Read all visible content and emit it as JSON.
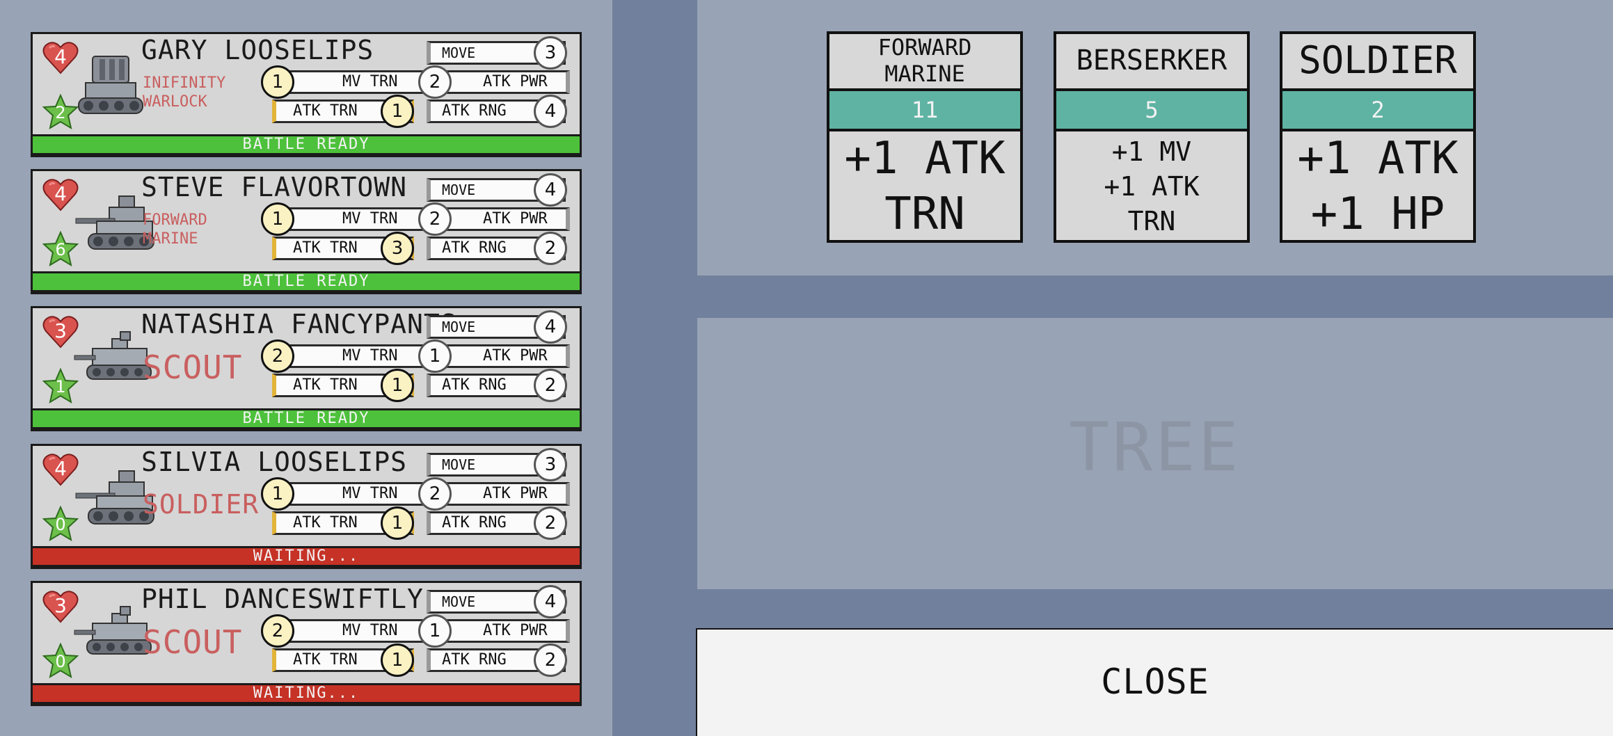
{
  "units": [
    {
      "name": "GARY LOOSELIPS",
      "unit_class": "INIFINITY WARLOCK",
      "class_size": "small",
      "hp": "4",
      "level": "2",
      "move": "3",
      "atk_pwr": "2",
      "atk_rng": "4",
      "mv_trn": "1",
      "atk_trn": "1",
      "status": "BATTLE READY",
      "ready": true,
      "tank": "mech"
    },
    {
      "name": "STEVE FLAVORTOWN",
      "unit_class": "FORWARD MARINE",
      "class_size": "small",
      "hp": "4",
      "level": "6",
      "move": "4",
      "atk_pwr": "2",
      "atk_rng": "2",
      "mv_trn": "1",
      "atk_trn": "3",
      "status": "BATTLE READY",
      "ready": true,
      "tank": "tank"
    },
    {
      "name": "NATASHIA FANCYPANTS",
      "unit_class": "SCOUT",
      "class_size": "large",
      "hp": "3",
      "level": "1",
      "move": "4",
      "atk_pwr": "1",
      "atk_rng": "2",
      "mv_trn": "2",
      "atk_trn": "1",
      "status": "BATTLE READY",
      "ready": true,
      "tank": "scout"
    },
    {
      "name": "SILVIA LOOSELIPS",
      "unit_class": "SOLDIER",
      "class_size": "medium",
      "hp": "4",
      "level": "0",
      "move": "3",
      "atk_pwr": "2",
      "atk_rng": "2",
      "mv_trn": "1",
      "atk_trn": "1",
      "status": "WAITING...",
      "ready": false,
      "tank": "tank"
    },
    {
      "name": "PHIL DANCESWIFTLY",
      "unit_class": "SCOUT",
      "class_size": "large",
      "hp": "3",
      "level": "0",
      "move": "4",
      "atk_pwr": "1",
      "atk_rng": "2",
      "mv_trn": "2",
      "atk_trn": "1",
      "status": "WAITING...",
      "ready": false,
      "tank": "scout"
    }
  ],
  "stat_labels": {
    "move": "MOVE",
    "mv_trn": "MV TRN",
    "atk_pwr": "ATK PWR",
    "atk_trn": "ATK TRN",
    "atk_rng": "ATK RNG"
  },
  "upgrades": [
    {
      "title_lines": [
        "FORWARD",
        "MARINE"
      ],
      "cost": "11",
      "effect_lines": [
        "+1 ATK",
        "TRN"
      ]
    },
    {
      "title_lines": [
        "BERSERKER"
      ],
      "cost": "5",
      "effect_lines": [
        "+1 MV",
        "+1 ATK",
        "TRN"
      ]
    },
    {
      "title_lines": [
        "SOLDIER"
      ],
      "cost": "2",
      "effect_lines": [
        "+1 ATK",
        "+1 HP"
      ]
    }
  ],
  "tree_label": "TREE",
  "close_label": "CLOSE",
  "colors": {
    "ready": "#4dc13b",
    "waiting": "#c63226",
    "cost_bar": "#5fb3a3",
    "class_text": "#c95f5f",
    "heart": "#d9534f",
    "star": "#6cbf4a"
  },
  "icons": {
    "hp": "heart-icon",
    "level": "star-icon"
  }
}
